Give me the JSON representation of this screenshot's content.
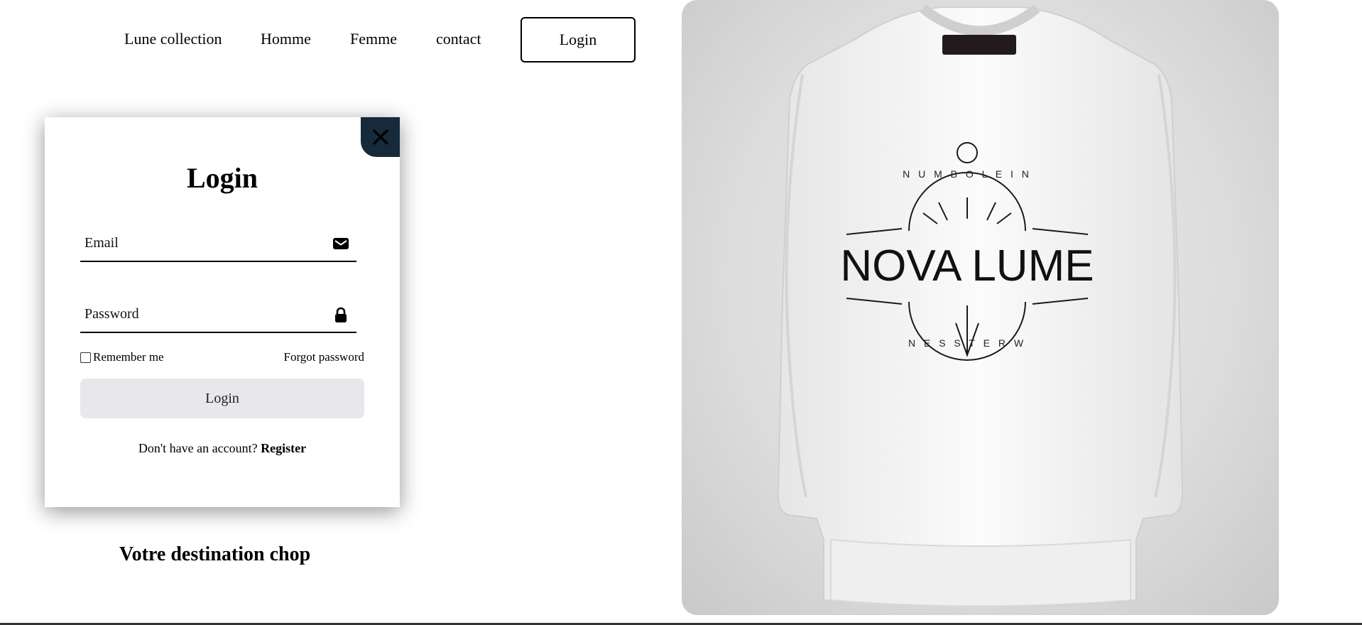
{
  "nav": {
    "links": [
      "Lune collection",
      "Homme",
      "Femme",
      "contact"
    ],
    "login_label": "Login"
  },
  "login_modal": {
    "title": "Login",
    "email_placeholder": "Email",
    "email_icon": "mail-icon",
    "password_placeholder": "Password",
    "password_icon": "lock-icon",
    "remember_label": "Remember me",
    "forgot_label": "Forgot password",
    "submit_label": "Login",
    "register_prompt": "Don't have an account?",
    "register_link": "Register",
    "close_icon": "close-icon"
  },
  "tagline": "Votre destination chop",
  "hero": {
    "brand": "NOVA LUME",
    "arc_top": "N U M B O L E I N",
    "arc_bottom": "N E S S T E R W",
    "colors": {
      "background": "#dcdcdc",
      "garment": "#f7f7f7",
      "ink": "#1a1a1a",
      "close_button": "#162a3b"
    }
  }
}
